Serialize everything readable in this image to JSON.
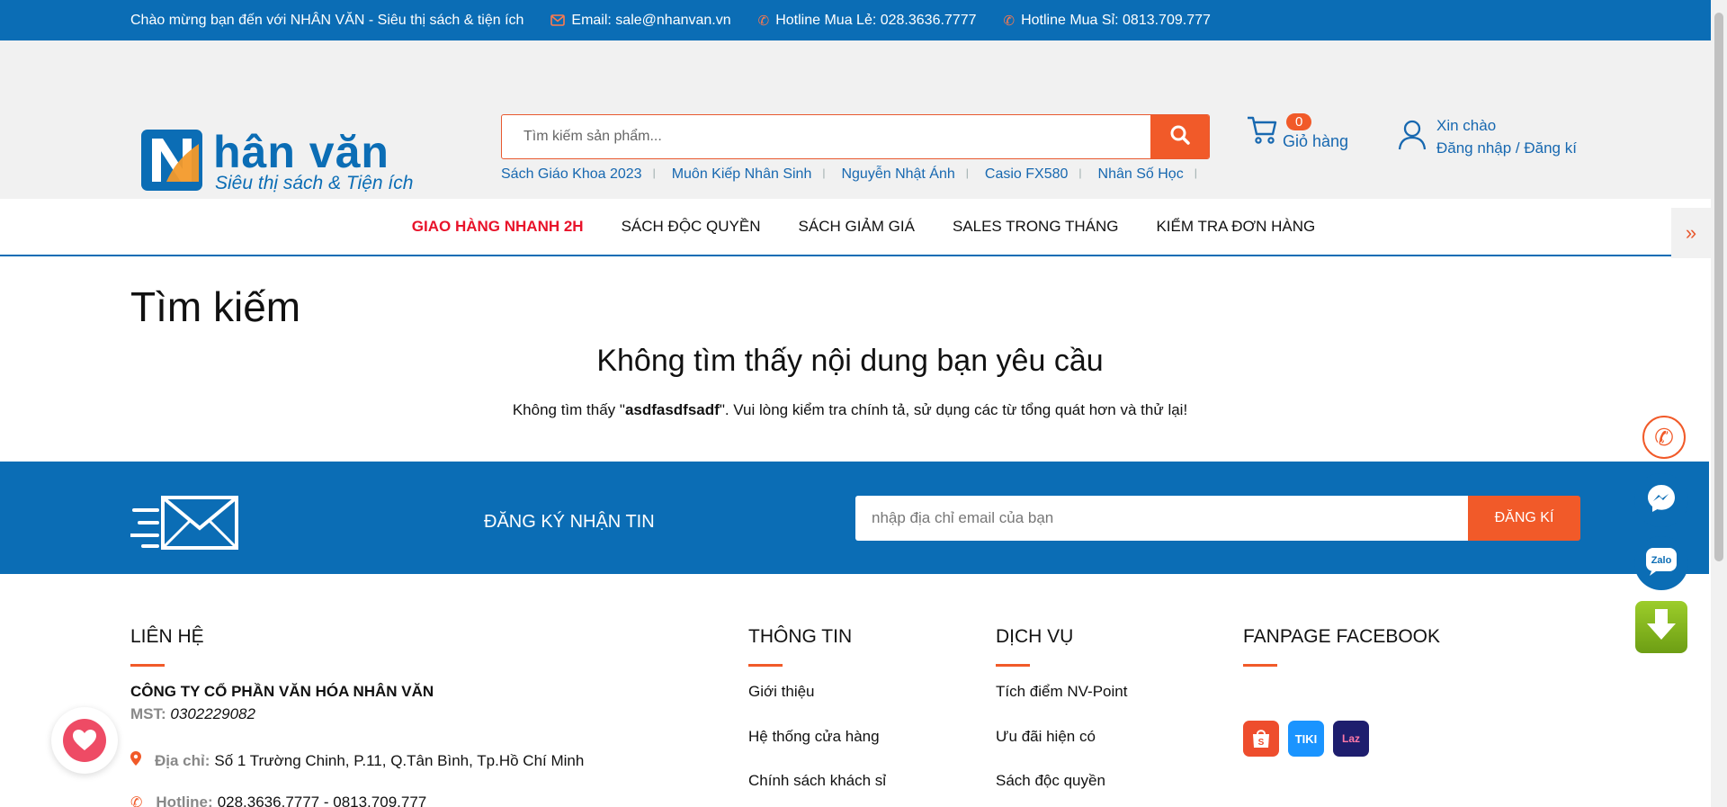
{
  "topbar": {
    "welcome": "Chào mừng bạn đến với NHÂN VĂN - Siêu thị sách & tiện ích",
    "email": "Email: sale@nhanvan.vn",
    "hotline_retail": "Hotline Mua Lẻ: 028.3636.7777",
    "hotline_wholesale": "Hotline Mua Sỉ: 0813.709.777"
  },
  "logo": {
    "main": "hân văn",
    "tagline": "Siêu thị sách & Tiện ích"
  },
  "search": {
    "placeholder": "Tìm kiếm sản phẩm..."
  },
  "keywords": [
    "Sách Giáo Khoa 2023",
    "Muôn Kiếp Nhân Sinh",
    "Nguyễn Nhật Ánh",
    "Casio FX580",
    "Nhân Số Học"
  ],
  "cart": {
    "count": "0",
    "label": "Giỏ hàng"
  },
  "account": {
    "greeting": "Xin chào",
    "action": "Đăng nhập / Đăng kí"
  },
  "nav": {
    "items": [
      "GIAO HÀNG NHANH 2H",
      "SÁCH ĐỘC QUYỀN",
      "SÁCH GIẢM GIÁ",
      "SALES TRONG THÁNG",
      "KIỂM TRA ĐƠN HÀNG"
    ]
  },
  "main": {
    "title": "Tìm kiếm",
    "empty_title": "Không tìm thấy nội dung bạn yêu cầu",
    "empty_prefix": "Không tìm thấy \"",
    "query": "asdfasdfsadf",
    "empty_suffix": "\". Vui lòng kiểm tra chính tả, sử dụng các từ tổng quát hơn và thử lại!"
  },
  "newsletter": {
    "title": "ĐĂNG KÝ NHẬN TIN",
    "placeholder": "nhập địa chỉ email của bạn",
    "button": "ĐĂNG KÍ"
  },
  "footer": {
    "contact_title": "LIÊN HỆ",
    "company": "CÔNG TY CỔ PHẦN VĂN HÓA NHÂN VĂN",
    "mst_label": "MST:",
    "mst": "0302229082",
    "address_label": "Địa chỉ:",
    "address": "Số 1 Trường Chinh, P.11, Q.Tân Bình, Tp.Hồ Chí Minh",
    "hotline_label": "Hotline:",
    "hotline": "028.3636.7777 - 0813.709.777",
    "info_title": "THÔNG TIN",
    "info_links": [
      "Giới thiệu",
      "Hệ thống cửa hàng",
      "Chính sách khách sỉ"
    ],
    "service_title": "DỊCH VỤ",
    "service_links": [
      "Tích điểm NV-Point",
      "Ưu đãi hiện có",
      "Sách độc quyền"
    ],
    "fanpage_title": "FANPAGE FACEBOOK",
    "shops": [
      "Shopee",
      "TIKI",
      "Laz"
    ]
  },
  "colors": {
    "brand_blue": "#0b6db5",
    "accent_orange": "#f15a29",
    "hot_red": "#e8132a"
  }
}
